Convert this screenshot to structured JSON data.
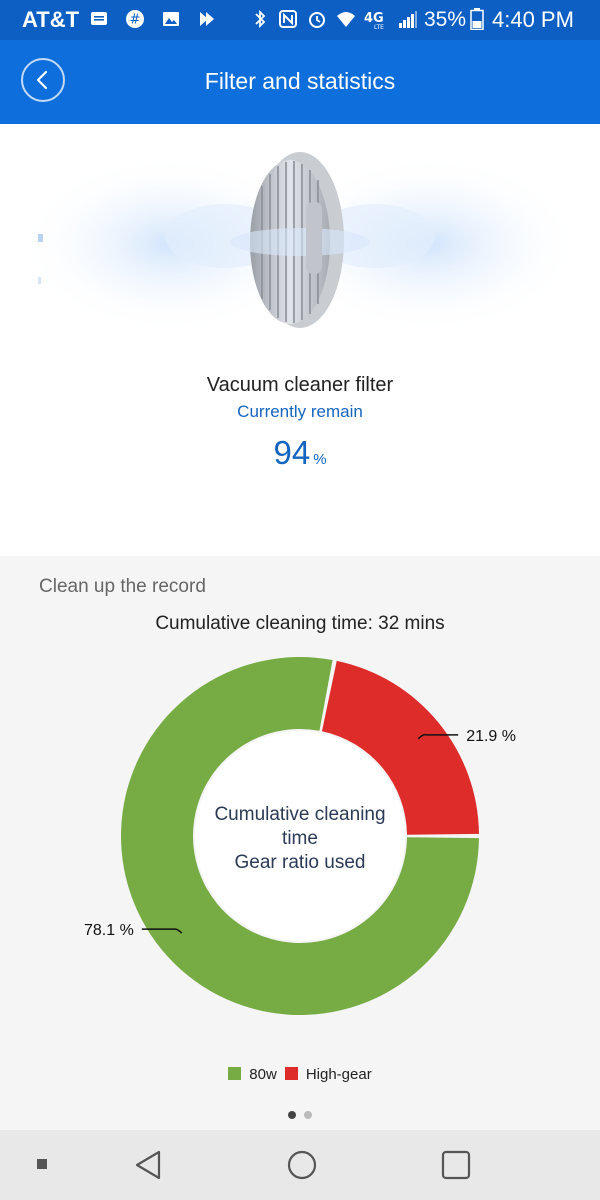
{
  "status_bar": {
    "carrier": "AT&T",
    "battery": "35%",
    "time": "4:40 PM"
  },
  "app_bar": {
    "title": "Filter and statistics",
    "back_icon": "back-arrow-icon"
  },
  "filter": {
    "name": "Vacuum cleaner filter",
    "remain_label": "Currently remain",
    "remain_value": "94",
    "remain_unit": "%"
  },
  "record": {
    "section_title": "Clean up the record",
    "cumulative_time": "Cumulative cleaning time: 32 mins"
  },
  "chart_data": {
    "type": "pie",
    "style": "donut",
    "center_text": [
      "Cumulative cleaning",
      "time",
      "Gear ratio used"
    ],
    "slices": [
      {
        "name": "80w",
        "value": 78.1,
        "label": "78.1 %",
        "color": "#76ac43"
      },
      {
        "name": "High-gear",
        "value": 21.9,
        "label": "21.9 %",
        "color": "#dd2c2a"
      }
    ],
    "legend_position": "bottom"
  },
  "pagination": {
    "pages": 2,
    "current": 1
  },
  "colors": {
    "status_bar": "#0d5fc4",
    "app_bar": "#0d6edc",
    "accent_text": "#1465c0"
  }
}
